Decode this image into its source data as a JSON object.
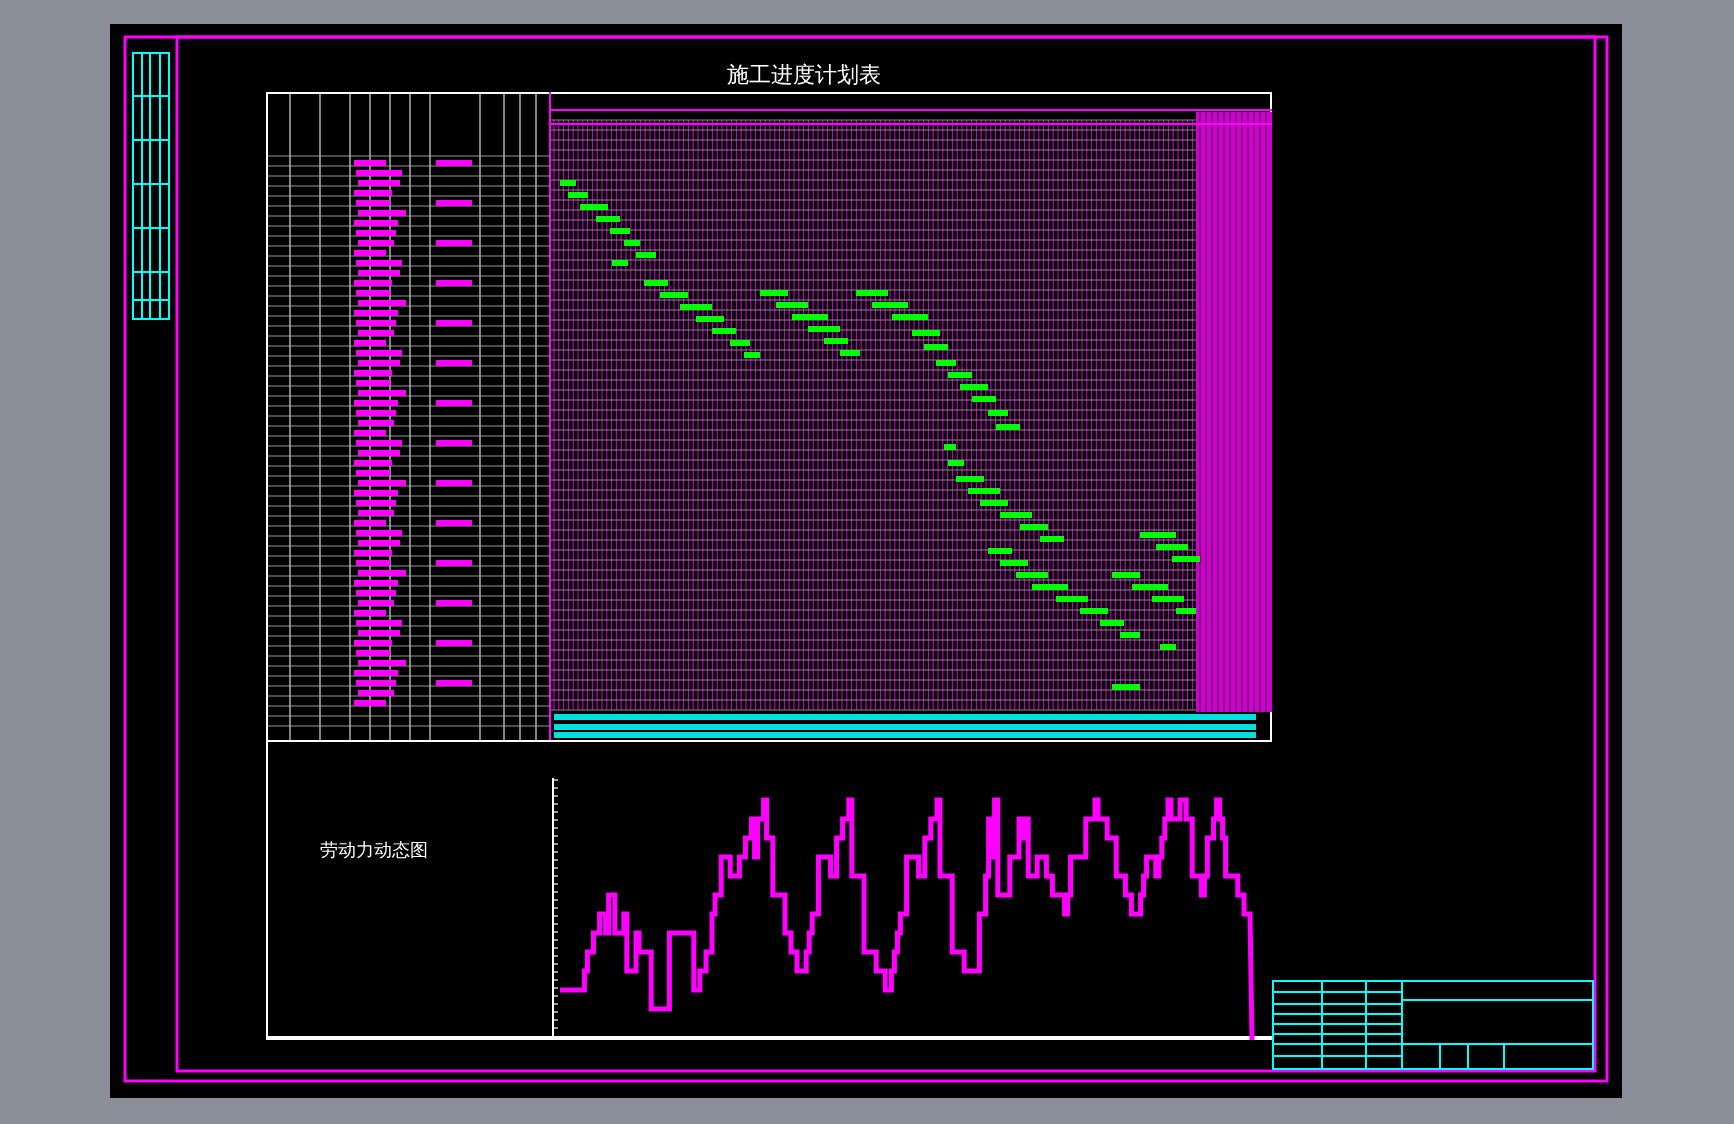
{
  "drawing": {
    "title": "施工进度计划表",
    "chart_caption": "劳动力动态图"
  }
}
